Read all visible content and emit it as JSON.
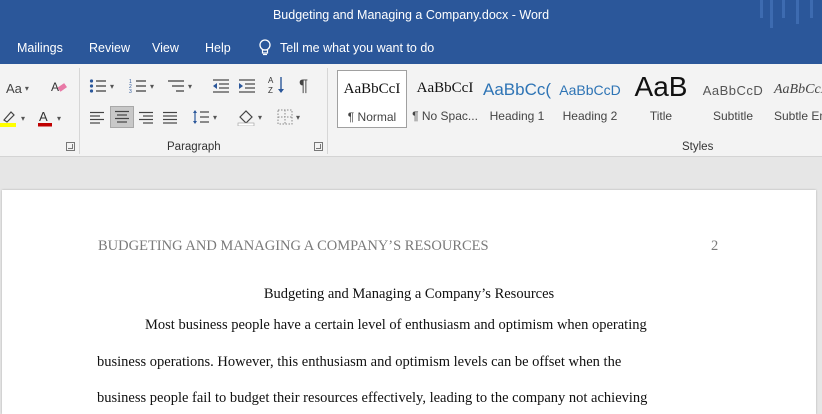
{
  "window": {
    "title": "Budgeting and Managing a Company.docx  -  Word"
  },
  "menu": {
    "items": [
      "Mailings",
      "Review",
      "View",
      "Help"
    ],
    "tell_me": "Tell me what you want to do"
  },
  "ribbon": {
    "font_group": {
      "font_size_label": "Aa",
      "colors": {
        "highlight": "#ffff00",
        "font_color": "#c00000"
      }
    },
    "paragraph_group": {
      "label": "Paragraph",
      "show_marks": "¶"
    },
    "styles_group": {
      "label": "Styles",
      "styles": [
        {
          "preview": "AaBbCcI",
          "name": "¶ Normal"
        },
        {
          "preview": "AaBbCcI",
          "name": "¶ No Spac..."
        },
        {
          "preview": "AaBbCc(",
          "name": "Heading 1"
        },
        {
          "preview": "AaBbCcD",
          "name": "Heading 2"
        },
        {
          "preview": "AaB",
          "name": "Title"
        },
        {
          "preview": "AaBbCcD",
          "name": "Subtitle"
        },
        {
          "preview": "AaBbCcD",
          "name": "Subtle Em"
        }
      ],
      "selected_style": "¶ Normal"
    }
  },
  "document": {
    "running_header": "BUDGETING AND MANAGING A COMPANY’S RESOURCES",
    "page_number": "2",
    "title": "Budgeting and Managing a Company’s Resources",
    "lines": [
      "Most business people have a certain level of enthusiasm and optimism when operating",
      "business operations. However, this enthusiasm and optimism levels can be offset when the",
      "business people fail to budget their resources effectively, leading to the company not achieving"
    ]
  },
  "colors": {
    "title_bar": "#2b579a",
    "ribbon": "#f3f3f3",
    "heading_blue": "#2e74b5"
  }
}
